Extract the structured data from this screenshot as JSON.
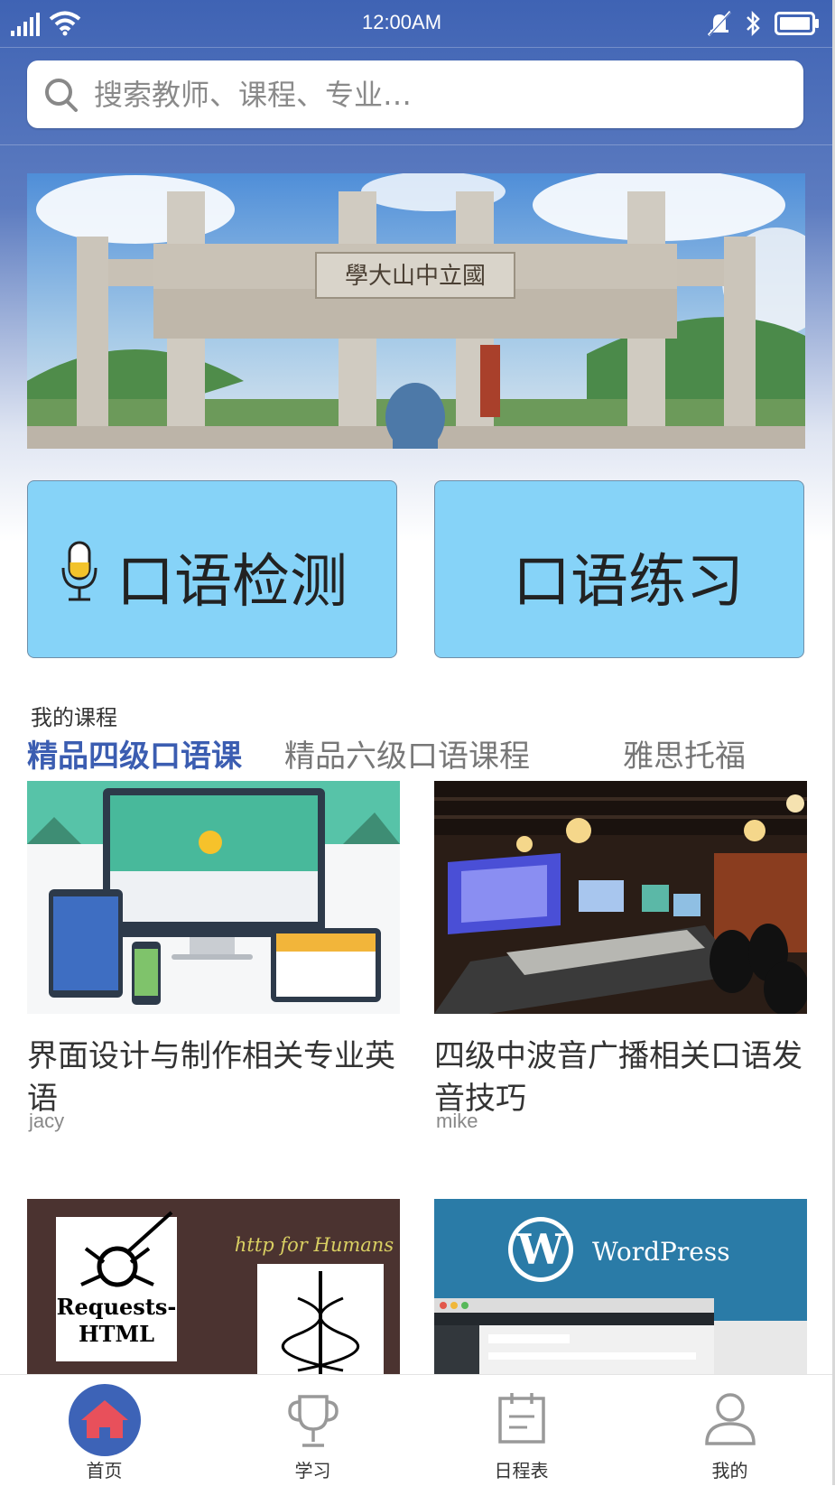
{
  "status": {
    "time": "12:00AM",
    "icons": [
      "signal-icon",
      "wifi-icon",
      "mute-icon",
      "bluetooth-icon",
      "battery-icon"
    ]
  },
  "search": {
    "placeholder": "搜索教师、课程、专业…"
  },
  "actions": {
    "oral_test": "口语检测",
    "oral_practice": "口语练习"
  },
  "courses": {
    "section_title": "我的课程",
    "tabs": [
      {
        "label": "精品四级口语课",
        "active": true
      },
      {
        "label": "精品六级口语课程",
        "active": false
      },
      {
        "label": "雅思托福",
        "active": false
      }
    ],
    "items": [
      {
        "title": "界面设计与制作相关专业英语",
        "author": "jacy"
      },
      {
        "title": "四级中波音广播相关口语发音技巧",
        "author": "mike"
      },
      {
        "thumb_text_1": "Requests-",
        "thumb_text_2": "HTML",
        "thumb_text_3": "http for Humans"
      },
      {
        "thumb_text": "WordPress"
      }
    ]
  },
  "tabbar": {
    "items": [
      {
        "label": "首页",
        "icon": "home-icon"
      },
      {
        "label": "学习",
        "icon": "trophy-icon"
      },
      {
        "label": "日程表",
        "icon": "calendar-icon"
      },
      {
        "label": "我的",
        "icon": "user-icon"
      }
    ]
  },
  "colors": {
    "header_blue": "#3f63b4",
    "button_blue": "#86d3f8",
    "active_tab": "#3b5db1",
    "home_circle": "#3d63b7",
    "home_icon": "#e8505b"
  }
}
